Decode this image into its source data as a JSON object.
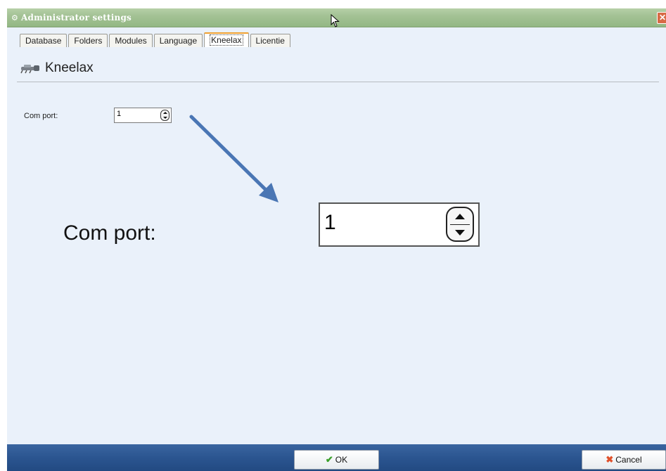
{
  "window": {
    "title": "Administrator settings",
    "close_glyph": "✕"
  },
  "tabs": [
    {
      "label": "Database",
      "active": false
    },
    {
      "label": "Folders",
      "active": false
    },
    {
      "label": "Modules",
      "active": false
    },
    {
      "label": "Language",
      "active": false
    },
    {
      "label": "Kneelax",
      "active": true
    },
    {
      "label": "Licentie",
      "active": false
    }
  ],
  "page": {
    "title": "Kneelax",
    "icon": "kneelax-device-icon"
  },
  "com_port": {
    "label": "Com port:",
    "value": "1"
  },
  "zoom_callout": {
    "label": "Com port:",
    "value": "1"
  },
  "buttons": {
    "ok_label": "OK",
    "cancel_label": "Cancel"
  },
  "colors": {
    "titlebar": "#a3c294",
    "background": "#eaf1fa",
    "bottombar": "#2b5590",
    "arrow": "#4a76b4",
    "active_tab_accent": "#f0a030"
  }
}
